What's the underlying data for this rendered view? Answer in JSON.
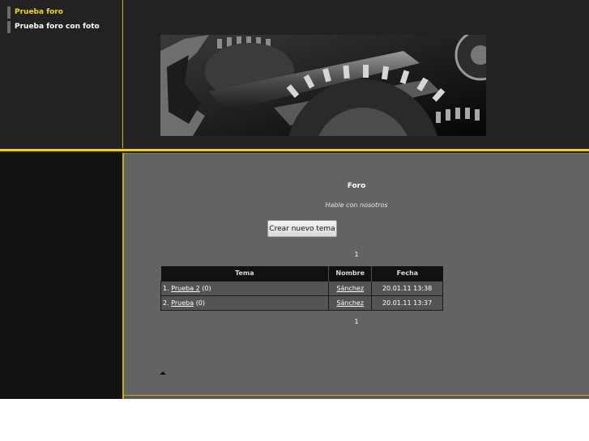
{
  "nav": {
    "items": [
      {
        "label": "Prueba foro",
        "active": true
      },
      {
        "label": "Prueba foro con foto",
        "active": false
      }
    ]
  },
  "banner": {
    "icon": "gears-photo"
  },
  "forum": {
    "title": "Foro",
    "subtitle": "Hable con nosotros",
    "new_topic_label": "Crear nuevo tema",
    "pager_top": "1",
    "pager_bottom": "1",
    "table": {
      "headers": {
        "tema": "Tema",
        "nombre": "Nombre",
        "fecha": "Fecha"
      },
      "rows": [
        {
          "num": "1.",
          "topic": "Prueba 2",
          "count": "(0)",
          "author": "Sánchez",
          "date": "20.01.11 13:38"
        },
        {
          "num": "2.",
          "topic": "Prueba",
          "count": "(0)",
          "author": "Sánchez",
          "date": "20.01.11 13:37"
        }
      ]
    }
  },
  "footer": {
    "top_link_icon": "arrow-up-icon"
  },
  "colors": {
    "accent_yellow": "#f2d300",
    "nav_active": "#f5d800",
    "content_bg": "#636363",
    "dark_bg": "#222222"
  }
}
